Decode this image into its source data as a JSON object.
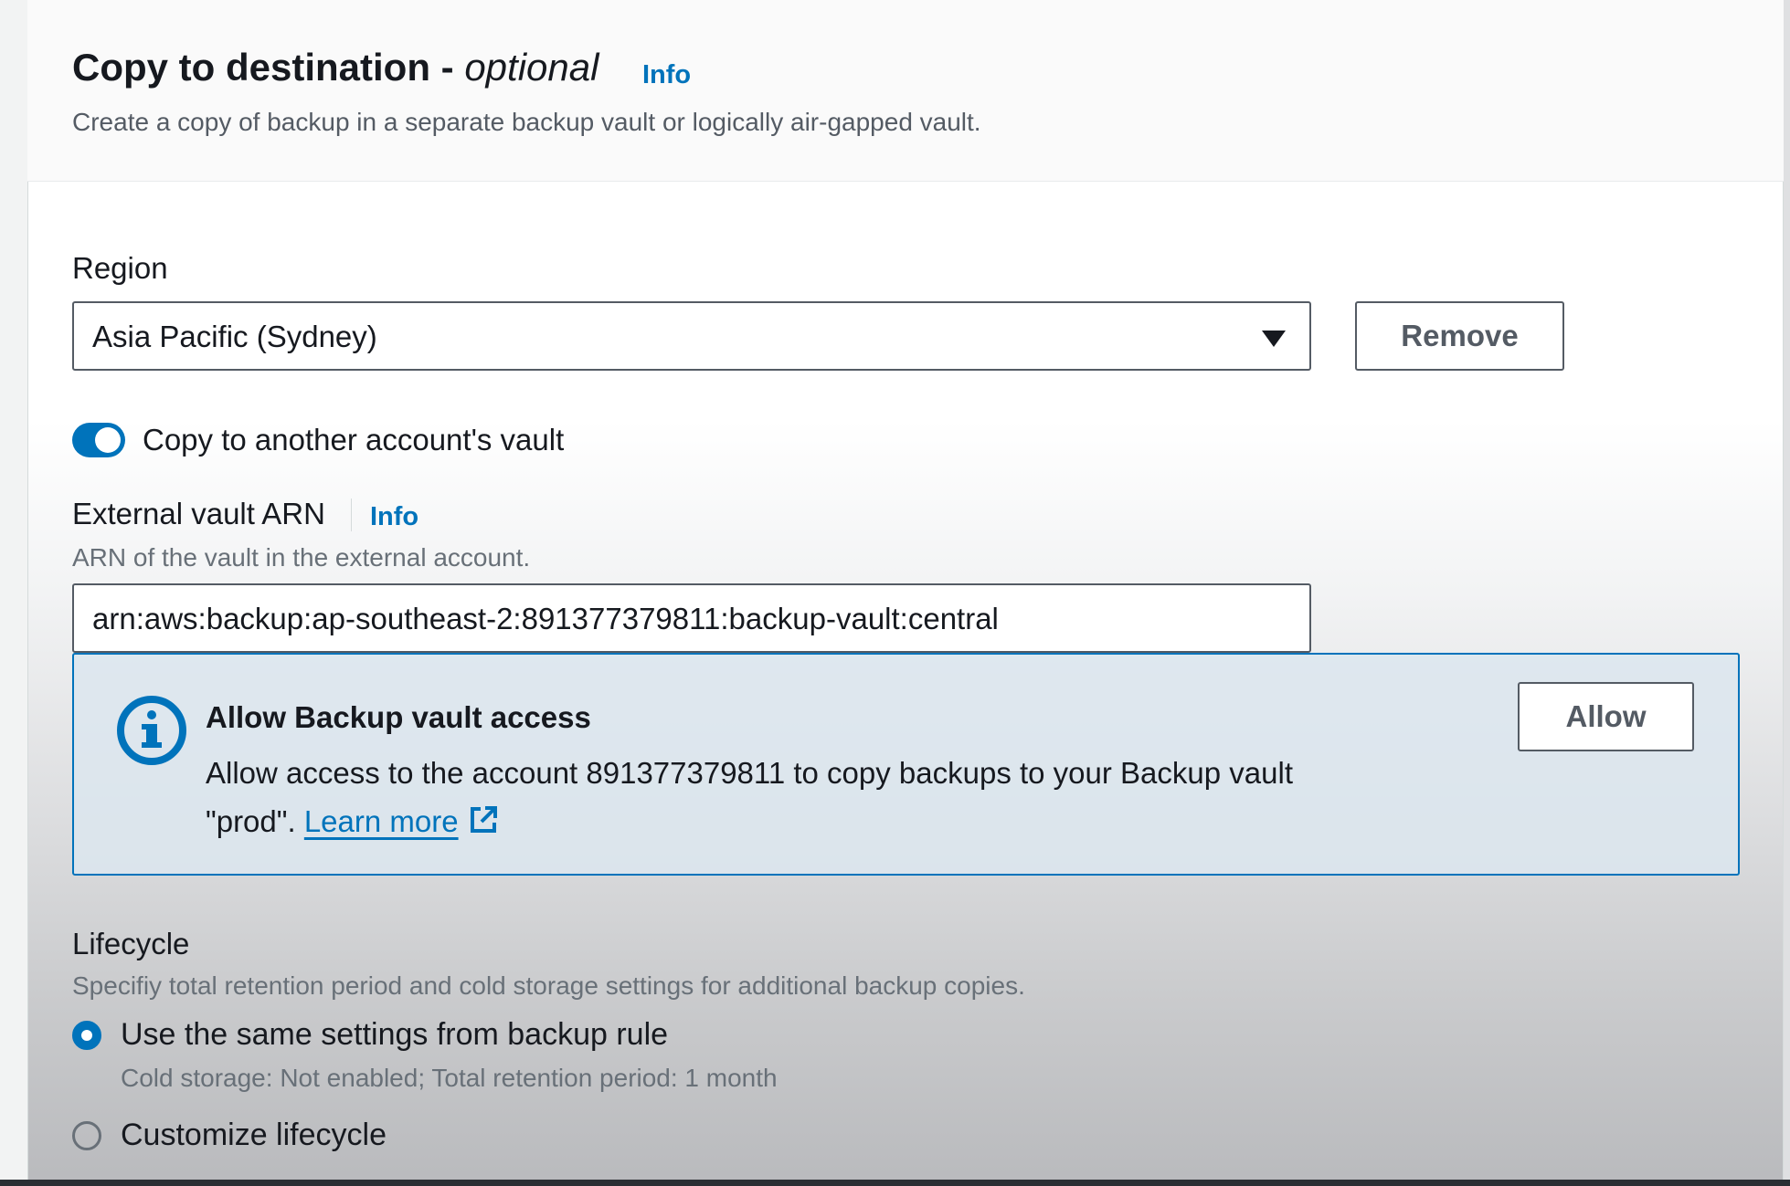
{
  "header": {
    "title_main": "Copy to destination -",
    "title_optional": "optional",
    "info_link": "Info",
    "description": "Create a copy of backup in a separate backup vault or logically air-gapped vault."
  },
  "region": {
    "label": "Region",
    "selected_value": "Asia Pacific (Sydney)",
    "remove_label": "Remove"
  },
  "cross_account_toggle": {
    "label": "Copy to another account's vault",
    "checked": true
  },
  "external_vault": {
    "label": "External vault ARN",
    "info_link": "Info",
    "description": "ARN of the vault in the external account.",
    "value": "arn:aws:backup:ap-southeast-2:891377379811:backup-vault:central"
  },
  "alert": {
    "title": "Allow Backup vault access",
    "body_line1": "Allow access to the account 891377379811 to copy backups to your Backup vault",
    "body_line2_prefix": "\"prod\". ",
    "learn_more": "Learn more",
    "allow_label": "Allow"
  },
  "lifecycle": {
    "label": "Lifecycle",
    "description": "Specifiy total retention period and cold storage settings for additional backup copies.",
    "options": [
      {
        "label": "Use the same settings from backup rule",
        "detail": "Cold storage: Not enabled; Total retention period: 1 month",
        "selected": true
      },
      {
        "label": "Customize lifecycle",
        "selected": false
      }
    ]
  },
  "colors": {
    "accent": "#0073bb",
    "text": "#16191f",
    "muted": "#687078"
  }
}
